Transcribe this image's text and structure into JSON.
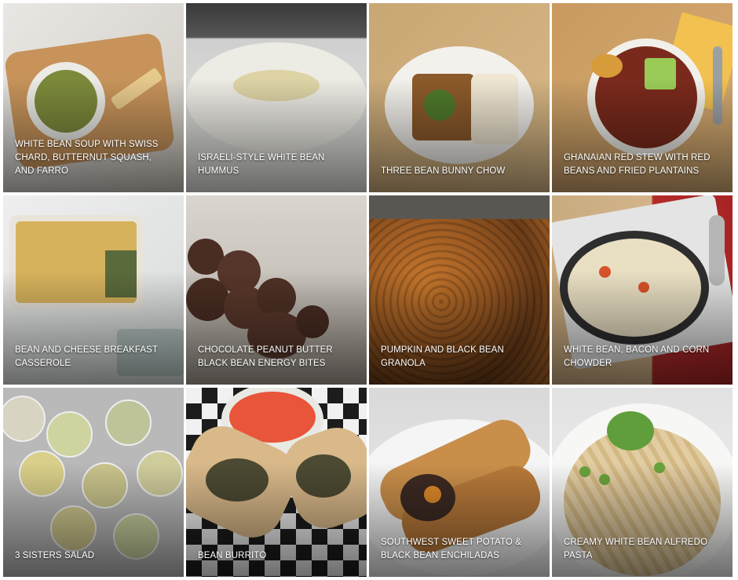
{
  "recipes": [
    {
      "title": "WHITE BEAN SOUP WITH SWISS CHARD, BUTTERNUT SQUASH, AND FARRO"
    },
    {
      "title": "ISRAELI-STYLE WHITE BEAN HUMMUS"
    },
    {
      "title": "THREE BEAN BUNNY CHOW"
    },
    {
      "title": "GHANAIAN RED STEW WITH RED BEANS AND FRIED PLANTAINS"
    },
    {
      "title": "BEAN AND CHEESE BREAKFAST CASSEROLE"
    },
    {
      "title": "CHOCOLATE PEANUT BUTTER BLACK BEAN ENERGY BITES"
    },
    {
      "title": "PUMPKIN AND BLACK BEAN GRANOLA"
    },
    {
      "title": "WHITE BEAN, BACON AND CORN CHOWDER"
    },
    {
      "title": "3 SISTERS SALAD"
    },
    {
      "title": "BEAN BURRITO"
    },
    {
      "title": "SOUTHWEST SWEET POTATO & BLACK BEAN ENCHILADAS"
    },
    {
      "title": "CREAMY WHITE BEAN ALFREDO PASTA"
    }
  ]
}
